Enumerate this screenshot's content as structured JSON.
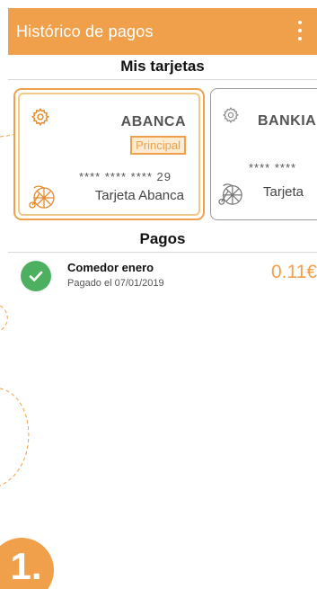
{
  "appbar": {
    "title": "Histórico de pagos",
    "menu_icon": "more-vert-icon"
  },
  "cards_section": {
    "title": "Mis tarjetas"
  },
  "cards": [
    {
      "bank": "ABANCA",
      "badge": "Principal",
      "number": "**** **** **** 29",
      "name": "Tarjeta Abanca",
      "selected": true
    },
    {
      "bank": "BANKIA",
      "number": "**** ****",
      "name": "Tarjeta",
      "selected": false
    }
  ],
  "payments_section": {
    "title": "Pagos"
  },
  "payments": [
    {
      "title": "Comedor enero",
      "subtitle": "Pagado el 07/01/2019",
      "amount": "0.11€",
      "status_icon": "check-circle-icon"
    }
  ],
  "step": {
    "label": "1."
  },
  "colors": {
    "accent": "#f0a04b",
    "success": "#4db060",
    "badge_bg": "#fdebd2"
  }
}
